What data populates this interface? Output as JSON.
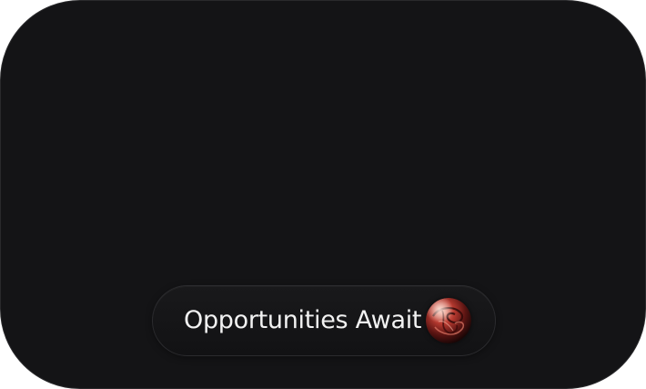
{
  "button": {
    "label": "Opportunities Await",
    "icon": "sphere-orb-icon"
  },
  "colors": {
    "card_background": "#141416",
    "page_background": "#ffffff",
    "button_text": "#f2f2f2",
    "orb_accent": "#c0392b"
  }
}
